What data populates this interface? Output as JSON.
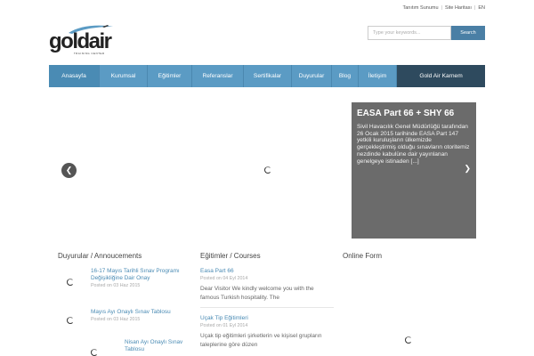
{
  "toplinks": [
    "Tanıtım Sunumu",
    "Site Haritası",
    "EN"
  ],
  "logo": {
    "word_gold": "gold",
    "word_air": "air",
    "subtitle": "TRAINING CENTER"
  },
  "search": {
    "placeholder": "Type your keywords...",
    "button": "Search"
  },
  "nav": [
    "Anasayfa",
    "Kurumsal",
    "Eğitimler",
    "Referanslar",
    "Sertifikalar",
    "Duyurular",
    "Blog",
    "İletişim",
    "Gold Air Karnem"
  ],
  "slider": {
    "caption_title": "EASA Part 66 + SHY 66",
    "caption_text": "Sivil Havacılık Genel Müdürlüğü tarafından 26 Ocak 2015 tarihinde EASA Part 147 yetkili kuruluşların ülkemizde gerçekleştirmiş olduğu sınavların otoritemiz nezdinde kabulüne dair yayınlanan genelgeye istinaden [...]"
  },
  "columns": {
    "announcements": {
      "title": "Duyurular / Annoucements",
      "items": [
        {
          "title": "16-17 Mayıs Tarihli Sınav Programı Değişikliğine Dair Onay",
          "date": "Posted on 03 Haz 2015"
        },
        {
          "title": "Mayıs Ayı Onaylı Sınav Tablosu",
          "date": "Posted on 03 Haz 2015"
        },
        {
          "title": "Nisan Ayı Onaylı Sınav Tablosu",
          "date": ""
        }
      ]
    },
    "courses": {
      "title": "Eğitimler / Courses",
      "items": [
        {
          "title": "Easa Part 66",
          "date": "Posted on 04 Eyl 2014",
          "excerpt": "Dear Visitor We kindly welcome you with the famous Turkish hospitality. The"
        },
        {
          "title": "Uçak Tip Eğitimleri",
          "date": "Posted on 01 Eyl 2014",
          "excerpt": "Uçak tip eğitimleri şirketlerin ve kişisel grupların taleplerine göre düzen"
        }
      ]
    },
    "online_form": {
      "title": "Online Form"
    }
  }
}
